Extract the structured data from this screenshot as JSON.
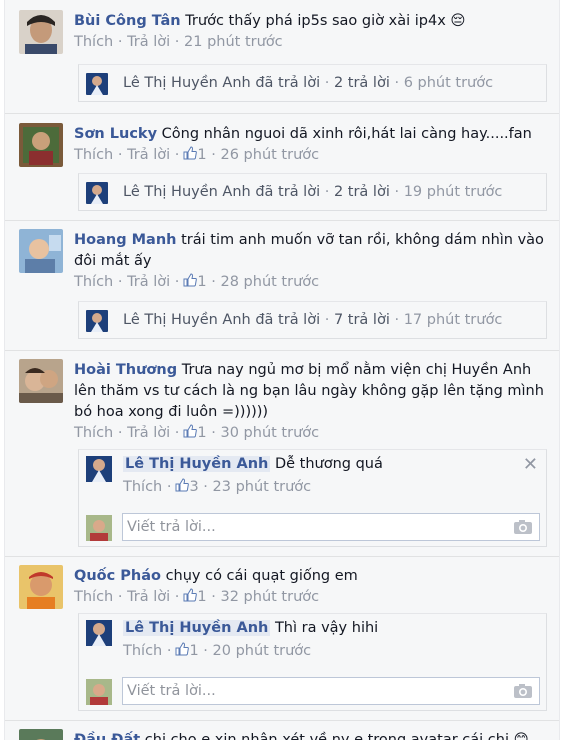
{
  "comments": [
    {
      "author": "Bùi Công Tân",
      "text": "Trước thấy phá ip5s sao giờ xài ip4x 😔",
      "action_like": "Thích",
      "action_reply": "Trả lời",
      "likes": "",
      "time": "21 phút trước",
      "reply_summary": {
        "name": "Lê Thị Huyền Anh",
        "verb": "đã trả lời",
        "count": "2 trả lời",
        "time": "6 phút trước"
      }
    },
    {
      "author": "Sơn Lucky",
      "text": "Công nhân nguoi dã xinh rôi,hát lai càng hay.....fan",
      "action_like": "Thích",
      "action_reply": "Trả lời",
      "likes": "1",
      "time": "26 phút trước",
      "reply_summary": {
        "name": "Lê Thị Huyền Anh",
        "verb": "đã trả lời",
        "count": "2 trả lời",
        "time": "19 phút trước"
      }
    },
    {
      "author": "Hoang Manh",
      "text": "trái tim anh muốn vỡ tan rồi, không dám nhìn vào đôi mắt ấy",
      "action_like": "Thích",
      "action_reply": "Trả lời",
      "likes": "1",
      "time": "28 phút trước",
      "reply_summary": {
        "name": "Lê Thị Huyền Anh",
        "verb": "đã trả lời",
        "count": "7 trả lời",
        "time": "17 phút trước"
      }
    },
    {
      "author": "Hoài Thương",
      "text": "Trưa nay ngủ mơ bị mổ nằm viện chị Huyền Anh lên thăm vs tư cách là ng bạn lâu ngày không gặp lên tặng mình bó hoa xong đi luôn =))))))",
      "action_like": "Thích",
      "action_reply": "Trả lời",
      "likes": "1",
      "time": "30 phút trước",
      "reply": {
        "author": "Lê Thị Huyền Anh",
        "text": "Dễ thương quá",
        "action_like": "Thích",
        "likes": "3",
        "time": "23 phút trước"
      },
      "write_placeholder": "Viết trả lời..."
    },
    {
      "author": "Quốc Pháo",
      "text": "chụy có cái quạt giống em",
      "action_like": "Thích",
      "action_reply": "Trả lời",
      "likes": "1",
      "time": "32 phút trước",
      "reply": {
        "author": "Lê Thị Huyền Anh",
        "text": "Thì ra vậy hihi",
        "action_like": "Thích",
        "likes": "1",
        "time": "20 phút trước"
      },
      "write_placeholder": "Viết trả lời..."
    },
    {
      "author": "Đầu Đất",
      "text": "chị cho e xin nhận xét về ny e trong avatar cái chị 😊"
    }
  ],
  "colors": {
    "link": "#3b5998",
    "meta": "#9197a3",
    "panel": "#f6f7f8"
  },
  "icons": {
    "like": "thumbs-up-icon",
    "camera": "camera-icon",
    "close": "close-icon"
  }
}
